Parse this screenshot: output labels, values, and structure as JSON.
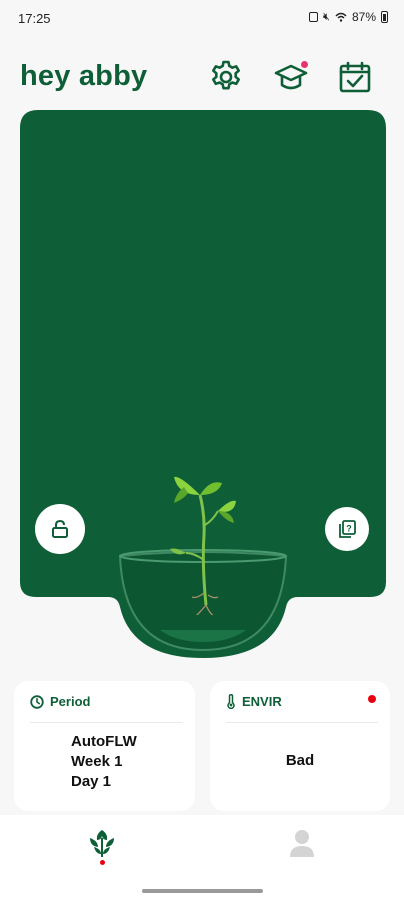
{
  "status_bar": {
    "time": "17:25",
    "battery": "87%"
  },
  "header": {
    "greeting": "hey abby",
    "icons": [
      "gear-icon",
      "graduation-cap-icon",
      "calendar-check-icon"
    ],
    "learn_has_notification": true
  },
  "grow_panel": {
    "background_color": "#0e5f37",
    "left_button_icon": "lock-icon",
    "right_button_icon": "help-cards-icon"
  },
  "cards": {
    "period": {
      "title": "Period",
      "icon": "clock-icon",
      "lines": [
        "AutoFLW",
        "Week 1",
        "Day 1"
      ]
    },
    "envir": {
      "title": "ENVIR",
      "icon": "thermometer-icon",
      "value": "Bad",
      "alert_color": "#e8000f"
    }
  },
  "bottom_nav": {
    "items": [
      "plant-icon",
      "profile-icon"
    ],
    "active": "plant-icon"
  },
  "colors": {
    "brand": "#0e5f37",
    "background": "#f7f7f7",
    "notification": "#e8336a"
  }
}
